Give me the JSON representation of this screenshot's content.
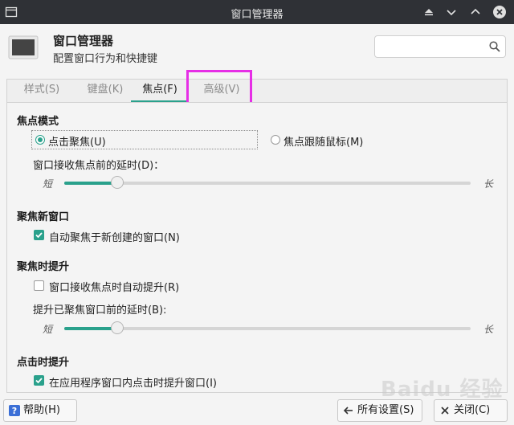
{
  "window": {
    "title": "窗口管理器"
  },
  "header": {
    "title": "窗口管理器",
    "subtitle": "配置窗口行为和快捷键",
    "search_placeholder": ""
  },
  "tabs": [
    {
      "label": "样式(S)",
      "active": false
    },
    {
      "label": "键盘(K)",
      "active": false
    },
    {
      "label": "焦点(F)",
      "active": true
    },
    {
      "label": "高级(V)",
      "active": false
    }
  ],
  "focus_mode": {
    "heading": "焦点模式",
    "option_click": "点击聚焦(U)",
    "option_follow": "焦点跟随鼠标(M)",
    "selected": "option_click",
    "delay_label": "窗口接收焦点前的延时(D)：",
    "slider_min": "短",
    "slider_max": "长",
    "delay_level": 0.13
  },
  "new_window_focus": {
    "heading": "聚焦新窗口",
    "checkbox_label": "自动聚焦于新创建的窗口(N)",
    "checked": true
  },
  "raise_on_focus": {
    "heading": "聚焦时提升",
    "checkbox_label": "窗口接收焦点时自动提升(R)",
    "checked": false,
    "delay_label": "提升已聚焦窗口前的延时(B):",
    "slider_min": "短",
    "slider_max": "长",
    "delay_level": 0.13
  },
  "raise_on_click": {
    "heading": "点击时提升",
    "checkbox_label": "在应用程序窗口内点击时提升窗口(I)",
    "checked": true
  },
  "footer": {
    "help_label": "帮助(H)",
    "all_settings_label": "所有设置(S)",
    "close_label": "关闭(C)"
  },
  "watermark": "Baidu 经验",
  "colors": {
    "accent": "#2aa18c",
    "titlebar_bg": "#2f3136",
    "highlight_box": "#e62ee6"
  },
  "icons": {
    "window": "window-icon",
    "app": "monitor-icon",
    "search": "search-icon",
    "eject": "eject-icon",
    "minimize": "chevron-down-icon",
    "maximize": "chevron-up-icon",
    "close": "close-icon",
    "help": "help-icon",
    "back": "arrow-left-icon"
  }
}
